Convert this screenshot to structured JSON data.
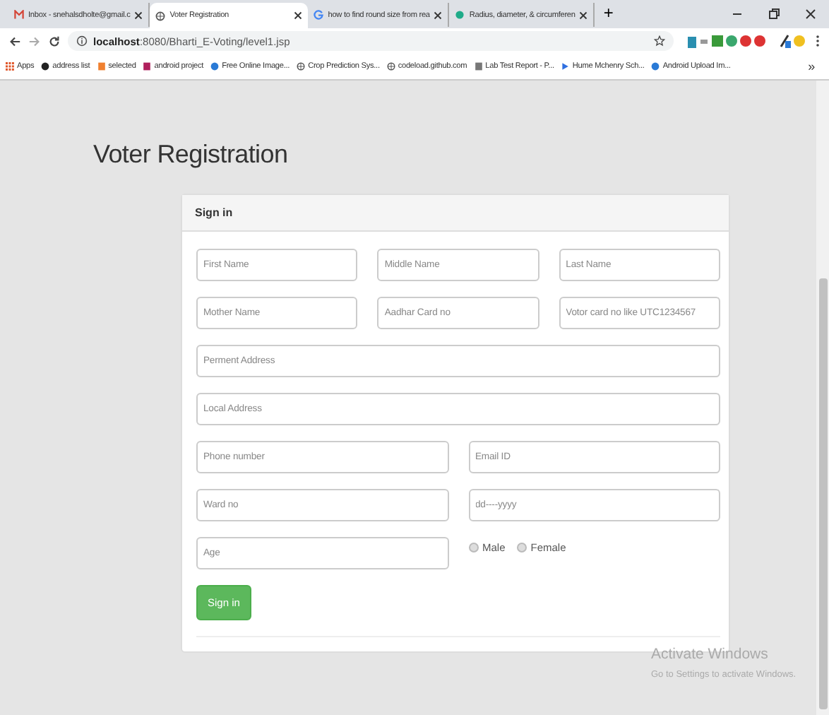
{
  "browser": {
    "tabs": [
      {
        "title": "Inbox - snehalsdholte@gmail.c",
        "kind": "mail",
        "selected": false
      },
      {
        "title": "Voter Registration",
        "kind": "globe",
        "selected": true
      },
      {
        "title": "how to find round size from rea",
        "kind": "google",
        "selected": false
      },
      {
        "title": "Radius, diameter, & circumferen",
        "kind": "leaf",
        "selected": false
      }
    ],
    "new_tab": "+",
    "url_host": "localhost",
    "url_rest": ":8080/Bharti_E-Voting/level1.jsp",
    "bookmarks": [
      {
        "label": "Apps",
        "kind": "grid"
      },
      {
        "label": "address list",
        "kind": "cat"
      },
      {
        "label": "selected",
        "kind": "orange"
      },
      {
        "label": "android project",
        "kind": "k"
      },
      {
        "label": "Free Online Image...",
        "kind": "drop"
      },
      {
        "label": "Crop Prediction Sys...",
        "kind": "globe"
      },
      {
        "label": "codeload.github.com",
        "kind": "globe"
      },
      {
        "label": "Lab Test Report - P...",
        "kind": "cells"
      },
      {
        "label": "Hume Mchenry Sch...",
        "kind": "play"
      },
      {
        "label": "Android Upload Im...",
        "kind": "drop"
      }
    ],
    "more": "»"
  },
  "page": {
    "title": "Voter Registration",
    "panel": {
      "heading": "Sign in",
      "rows": [
        {
          "fields": [
            {
              "placeholder": "First Name"
            },
            {
              "placeholder": "Middle Name"
            },
            {
              "placeholder": "Last Name"
            }
          ]
        },
        {
          "fields": [
            {
              "placeholder": "Mother Name"
            },
            {
              "placeholder": "Aadhar Card no"
            },
            {
              "placeholder": "Votor card no like UTC1234567"
            }
          ]
        },
        {
          "fields": [
            {
              "placeholder": "Perment Address"
            }
          ]
        },
        {
          "fields": [
            {
              "placeholder": "Local Address"
            }
          ]
        },
        {
          "fields": [
            {
              "placeholder": "Phone number"
            },
            {
              "placeholder": "Email ID"
            }
          ]
        },
        {
          "fields": [
            {
              "placeholder": "Ward no"
            },
            {
              "placeholder": "dd----yyyy"
            }
          ]
        }
      ],
      "age": {
        "placeholder": "Age"
      },
      "gender": [
        {
          "label": "Male",
          "selected": false
        },
        {
          "label": "Female",
          "selected": false
        }
      ],
      "submit": "Sign in"
    }
  },
  "activation": {
    "title": "Activate Windows",
    "note": "Go to Settings to activate Windows."
  }
}
